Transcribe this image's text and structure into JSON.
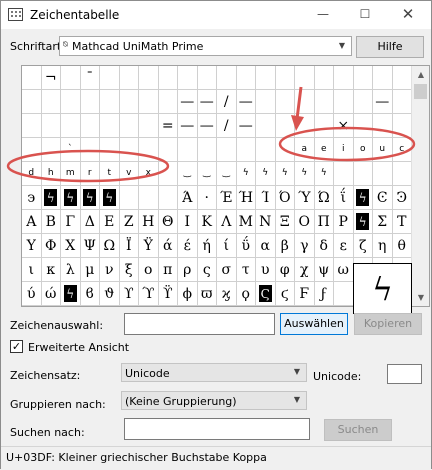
{
  "window": {
    "title": "Zeichentabelle",
    "minimize": "—",
    "maximize": "☐",
    "close": "✕"
  },
  "font": {
    "label": "Schriftart:",
    "value": "Mathcad UniMath Prime",
    "type_glyph": "⍉",
    "help_button": "Hilfe"
  },
  "grid": {
    "cells": [
      "",
      "¬",
      "",
      "¯",
      "",
      "",
      "",
      "",
      "",
      "",
      "",
      "",
      "",
      "",
      "",
      "",
      "",
      "",
      "",
      "",
      "",
      "",
      "",
      "",
      "",
      "",
      "",
      "",
      "—",
      "—",
      "/",
      "—",
      "",
      "",
      "",
      "",
      "",
      "",
      "—",
      "",
      "",
      "",
      "",
      "",
      "",
      "",
      "",
      "=",
      "—",
      "—",
      "/",
      "—",
      "",
      "",
      "",
      "",
      "×",
      "",
      "",
      "",
      "",
      "",
      "",
      "",
      "",
      "",
      "",
      "",
      "",
      "",
      "",
      "",
      "",
      "",
      "",
      "",
      "",
      "",
      "",
      "",
      "",
      "",
      "",
      "",
      "",
      "",
      "",
      "",
      "",
      "",
      "",
      "",
      "",
      "",
      "",
      "",
      "",
      "",
      "",
      "",
      "϶",
      "ϟ",
      "ϟ",
      "ϟ",
      "ϟ",
      "",
      "",
      "",
      "Ά",
      "·",
      "Έ",
      "Ή",
      "Ί",
      "Ό",
      "Ύ",
      "Ώ",
      "ΐ",
      "ϟ",
      "Ͼ",
      "Ͽ",
      "Α",
      "Β",
      "Γ",
      "Δ",
      "Ε",
      "Ζ",
      "Η",
      "Θ",
      "Ι",
      "Κ",
      "Λ",
      "Μ",
      "Ν",
      "Ξ",
      "Ο",
      "Π",
      "Ρ",
      "ϟ",
      "Σ",
      "Τ",
      "Υ",
      "Φ",
      "Χ",
      "Ψ",
      "Ω",
      "Ϊ",
      "Ϋ",
      "ά",
      "έ",
      "ή",
      "ί",
      "ΰ",
      "α",
      "β",
      "γ",
      "δ",
      "ε",
      "ζ",
      "η",
      "θ",
      "ι",
      "κ",
      "λ",
      "μ",
      "ν",
      "ξ",
      "ο",
      "π",
      "ρ",
      "ς",
      "σ",
      "τ",
      "υ",
      "φ",
      "χ",
      "ψ",
      "ω",
      "ϊ",
      "",
      "",
      "ύ",
      "ώ",
      "ϟ",
      "ϐ",
      "ϑ",
      "ϒ",
      "ϓ",
      "ϔ",
      "ϕ",
      "ϖ",
      "ϗ",
      "ϙ",
      "Ϛ",
      "ϛ",
      "Ϝ",
      "ϝ",
      "",
      "",
      "",
      ""
    ],
    "inverse_cells": [
      101,
      102,
      103,
      104,
      117,
      137,
      182,
      192
    ],
    "small_cells": [
      60,
      61,
      62,
      63,
      64,
      65,
      66,
      67,
      68,
      69,
      70,
      71,
      72,
      73,
      74,
      75,
      76,
      77,
      78,
      79,
      80,
      81,
      82,
      83,
      84,
      85,
      86,
      87,
      88,
      89,
      90,
      91,
      92,
      93,
      94,
      95,
      96,
      97,
      98,
      99
    ],
    "row4": [
      "",
      "",
      "`",
      "",
      "",
      "",
      "",
      "",
      "",
      "",
      "",
      "",
      "",
      "",
      "a",
      "e",
      "i",
      "o",
      "u",
      "c"
    ],
    "row5": [
      "d",
      "h",
      "m",
      "r",
      "t",
      "v",
      "x",
      "",
      "‿",
      "‿",
      "‿",
      "ϟ",
      "ϟ",
      "ϟ",
      "ϟ",
      "ϟ",
      "",
      "",
      "",
      ""
    ],
    "row0": [
      "",
      "¬",
      "",
      "¯",
      "",
      "",
      "",
      "",
      "",
      "",
      "",
      "",
      "",
      "",
      "",
      "",
      "",
      "",
      "",
      ""
    ]
  },
  "zoom_char": "ϟ",
  "selection": {
    "label": "Zeichenauswahl:",
    "value": "",
    "select_button": "Auswählen",
    "copy_button": "Kopieren"
  },
  "advanced": {
    "label": "Erweiterte Ansicht",
    "checked": "✓"
  },
  "charset": {
    "label": "Zeichensatz:",
    "value": "Unicode"
  },
  "unicode": {
    "label": "Unicode:",
    "value": ""
  },
  "group": {
    "label": "Gruppieren nach:",
    "value": "(Keine Gruppierung)"
  },
  "search": {
    "label": "Suchen nach:",
    "value": "",
    "button": "Suchen"
  },
  "status": "U+03DF: Kleiner griechischer Buchstabe Koppa",
  "colors": {
    "annotation": "#d9534f"
  }
}
